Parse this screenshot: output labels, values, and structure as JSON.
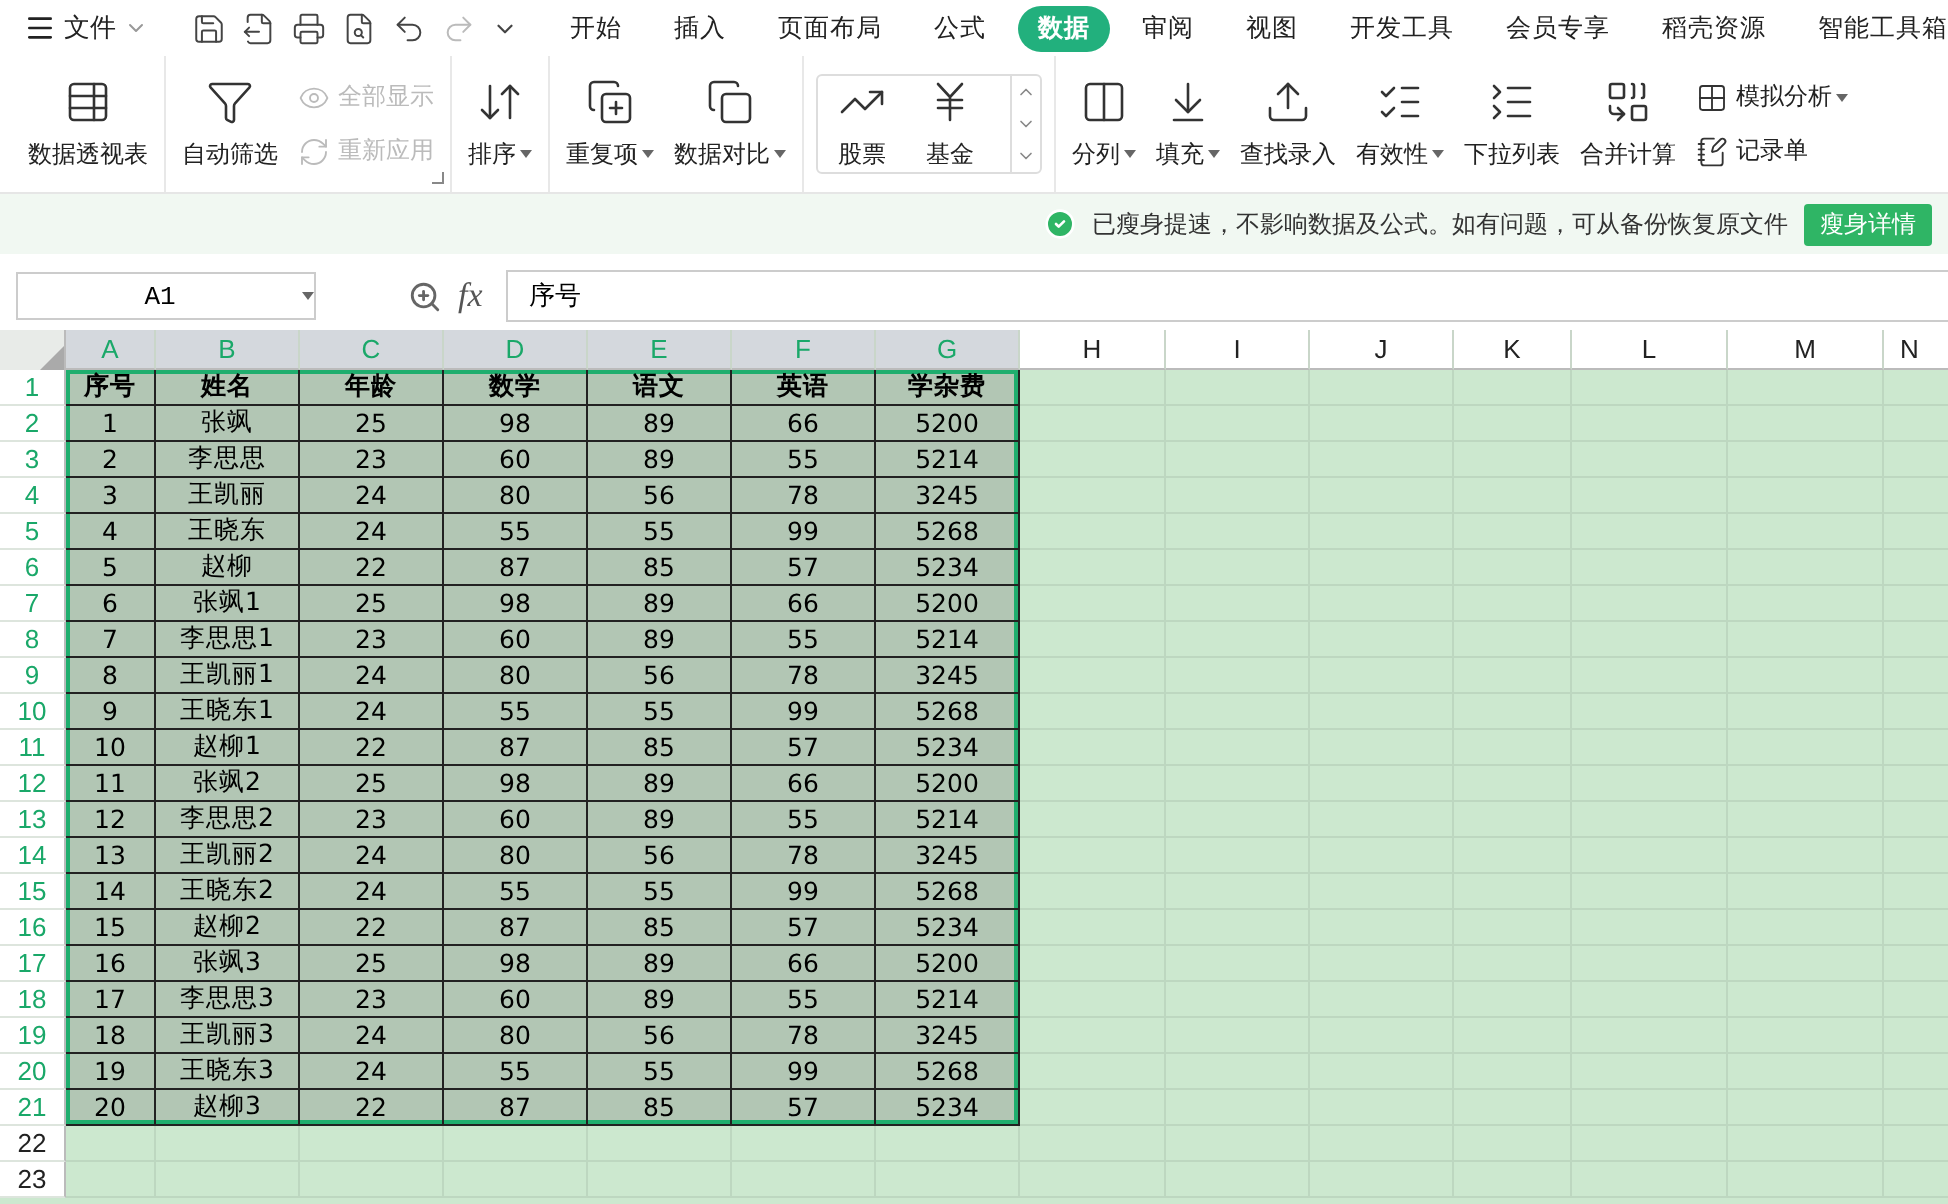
{
  "menu": {
    "file": "文件",
    "tabs": [
      {
        "label": "开始",
        "selected": false
      },
      {
        "label": "插入",
        "selected": false
      },
      {
        "label": "页面布局",
        "selected": false
      },
      {
        "label": "公式",
        "selected": false
      },
      {
        "label": "数据",
        "selected": true
      },
      {
        "label": "审阅",
        "selected": false
      },
      {
        "label": "视图",
        "selected": false
      },
      {
        "label": "开发工具",
        "selected": false
      },
      {
        "label": "会员专享",
        "selected": false
      },
      {
        "label": "稻壳资源",
        "selected": false
      },
      {
        "label": "智能工具箱",
        "selected": false
      }
    ]
  },
  "ribbon": [
    {
      "kind": "buttons",
      "items": [
        {
          "kind": "large",
          "label": "数据透视表",
          "dropdown": false,
          "disabled": false
        }
      ]
    },
    {
      "kind": "buttons",
      "launcher": true,
      "items": [
        {
          "kind": "large",
          "label": "自动筛选",
          "dropdown": false,
          "disabled": false
        },
        {
          "kind": "small",
          "label": "全部显示",
          "dropdown": false,
          "disabled": true
        },
        {
          "kind": "small",
          "label": "重新应用",
          "dropdown": false,
          "disabled": true
        }
      ]
    },
    {
      "kind": "buttons",
      "items": [
        {
          "kind": "large",
          "label": "排序",
          "dropdown": true,
          "disabled": false
        }
      ]
    },
    {
      "kind": "buttons",
      "items": [
        {
          "kind": "large",
          "label": "重复项",
          "dropdown": true,
          "disabled": false
        },
        {
          "kind": "large",
          "label": "数据对比",
          "dropdown": true,
          "disabled": false
        }
      ]
    },
    {
      "kind": "gallery",
      "items": [
        {
          "kind": "large",
          "label": "股票",
          "dropdown": false,
          "disabled": false
        },
        {
          "kind": "large",
          "label": "基金",
          "dropdown": false,
          "disabled": false
        }
      ]
    },
    {
      "kind": "buttons",
      "items": [
        {
          "kind": "large",
          "label": "分列",
          "dropdown": true,
          "disabled": false
        },
        {
          "kind": "large",
          "label": "填充",
          "dropdown": true,
          "disabled": false
        },
        {
          "kind": "large",
          "label": "查找录入",
          "dropdown": false,
          "disabled": false
        },
        {
          "kind": "large",
          "label": "有效性",
          "dropdown": true,
          "disabled": false
        },
        {
          "kind": "large",
          "label": "下拉列表",
          "dropdown": false,
          "disabled": false
        },
        {
          "kind": "large",
          "label": "合并计算",
          "dropdown": false,
          "disabled": false
        },
        {
          "kind": "small",
          "label": "模拟分析",
          "dropdown": true,
          "disabled": false
        },
        {
          "kind": "small",
          "label": "记录单",
          "dropdown": false,
          "disabled": false
        }
      ]
    }
  ],
  "notice": {
    "text": "已瘦身提速，不影响数据及公式。如有问题，可从备份恢复原文件",
    "button": "瘦身详情"
  },
  "formula_bar": {
    "name_box": "A1",
    "fx": "fx",
    "value": "序号"
  },
  "sheet": {
    "columns": [
      {
        "label": "A",
        "selected": true
      },
      {
        "label": "B",
        "selected": true
      },
      {
        "label": "C",
        "selected": true
      },
      {
        "label": "D",
        "selected": true
      },
      {
        "label": "E",
        "selected": true
      },
      {
        "label": "F",
        "selected": true
      },
      {
        "label": "G",
        "selected": true
      },
      {
        "label": "H",
        "selected": false
      },
      {
        "label": "I",
        "selected": false
      },
      {
        "label": "J",
        "selected": false
      },
      {
        "label": "K",
        "selected": false
      },
      {
        "label": "L",
        "selected": false
      },
      {
        "label": "M",
        "selected": false
      },
      {
        "label": "N",
        "selected": false
      }
    ],
    "rows": [
      {
        "number": "1",
        "selected": true,
        "kind": "header",
        "cells": [
          "序号",
          "姓名",
          "年龄",
          "数学",
          "语文",
          "英语",
          "学杂费"
        ]
      },
      {
        "number": "2",
        "selected": true,
        "kind": "data",
        "cells": [
          "1",
          "张飒",
          "25",
          "98",
          "89",
          "66",
          "5200"
        ]
      },
      {
        "number": "3",
        "selected": true,
        "kind": "data",
        "cells": [
          "2",
          "李思思",
          "23",
          "60",
          "89",
          "55",
          "5214"
        ]
      },
      {
        "number": "4",
        "selected": true,
        "kind": "data",
        "cells": [
          "3",
          "王凯丽",
          "24",
          "80",
          "56",
          "78",
          "3245"
        ]
      },
      {
        "number": "5",
        "selected": true,
        "kind": "data",
        "cells": [
          "4",
          "王晓东",
          "24",
          "55",
          "55",
          "99",
          "5268"
        ]
      },
      {
        "number": "6",
        "selected": true,
        "kind": "data",
        "cells": [
          "5",
          "赵柳",
          "22",
          "87",
          "85",
          "57",
          "5234"
        ]
      },
      {
        "number": "7",
        "selected": true,
        "kind": "data",
        "cells": [
          "6",
          "张飒1",
          "25",
          "98",
          "89",
          "66",
          "5200"
        ]
      },
      {
        "number": "8",
        "selected": true,
        "kind": "data",
        "cells": [
          "7",
          "李思思1",
          "23",
          "60",
          "89",
          "55",
          "5214"
        ]
      },
      {
        "number": "9",
        "selected": true,
        "kind": "data",
        "cells": [
          "8",
          "王凯丽1",
          "24",
          "80",
          "56",
          "78",
          "3245"
        ]
      },
      {
        "number": "10",
        "selected": true,
        "kind": "data",
        "cells": [
          "9",
          "王晓东1",
          "24",
          "55",
          "55",
          "99",
          "5268"
        ]
      },
      {
        "number": "11",
        "selected": true,
        "kind": "data",
        "cells": [
          "10",
          "赵柳1",
          "22",
          "87",
          "85",
          "57",
          "5234"
        ]
      },
      {
        "number": "12",
        "selected": true,
        "kind": "data",
        "cells": [
          "11",
          "张飒2",
          "25",
          "98",
          "89",
          "66",
          "5200"
        ]
      },
      {
        "number": "13",
        "selected": true,
        "kind": "data",
        "cells": [
          "12",
          "李思思2",
          "23",
          "60",
          "89",
          "55",
          "5214"
        ]
      },
      {
        "number": "14",
        "selected": true,
        "kind": "data",
        "cells": [
          "13",
          "王凯丽2",
          "24",
          "80",
          "56",
          "78",
          "3245"
        ]
      },
      {
        "number": "15",
        "selected": true,
        "kind": "data",
        "cells": [
          "14",
          "王晓东2",
          "24",
          "55",
          "55",
          "99",
          "5268"
        ]
      },
      {
        "number": "16",
        "selected": true,
        "kind": "data",
        "cells": [
          "15",
          "赵柳2",
          "22",
          "87",
          "85",
          "57",
          "5234"
        ]
      },
      {
        "number": "17",
        "selected": true,
        "kind": "data",
        "cells": [
          "16",
          "张飒3",
          "25",
          "98",
          "89",
          "66",
          "5200"
        ]
      },
      {
        "number": "18",
        "selected": true,
        "kind": "data",
        "cells": [
          "17",
          "李思思3",
          "23",
          "60",
          "89",
          "55",
          "5214"
        ]
      },
      {
        "number": "19",
        "selected": true,
        "kind": "data",
        "cells": [
          "18",
          "王凯丽3",
          "24",
          "80",
          "56",
          "78",
          "3245"
        ]
      },
      {
        "number": "20",
        "selected": true,
        "kind": "data",
        "cells": [
          "19",
          "王晓东3",
          "24",
          "55",
          "55",
          "99",
          "5268"
        ]
      },
      {
        "number": "21",
        "selected": true,
        "kind": "data",
        "cells": [
          "20",
          "赵柳3",
          "22",
          "87",
          "85",
          "57",
          "5234"
        ]
      },
      {
        "number": "22",
        "selected": false,
        "kind": "empty",
        "cells": []
      },
      {
        "number": "23",
        "selected": false,
        "kind": "empty",
        "cells": []
      }
    ]
  }
}
